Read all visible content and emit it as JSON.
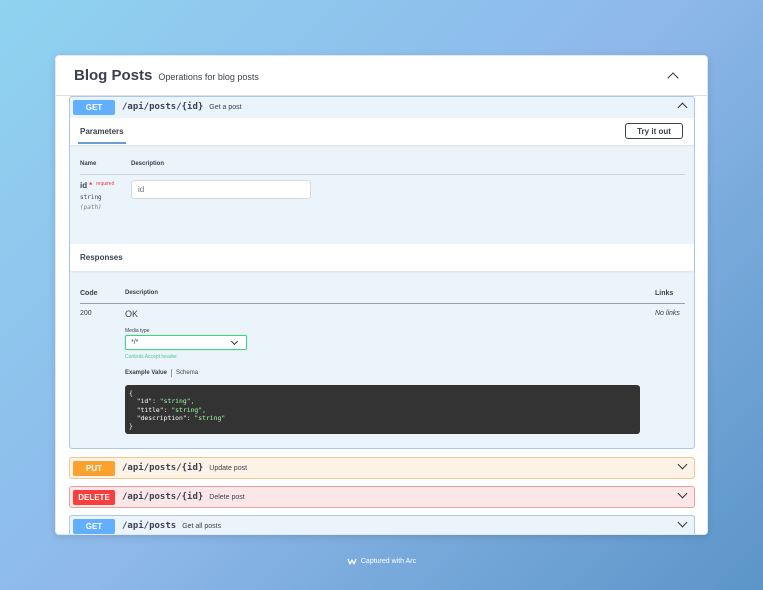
{
  "tag": {
    "title": "Blog Posts",
    "description": "Operations for blog posts"
  },
  "operations": [
    {
      "method": "GET",
      "path": "/api/posts/{id}",
      "summary": "Get a post",
      "color": "#61affe"
    },
    {
      "method": "PUT",
      "path": "/api/posts/{id}",
      "summary": "Update post",
      "color": "#fca130"
    },
    {
      "method": "DELETE",
      "path": "/api/posts/{id}",
      "summary": "Delete post",
      "color": "#f93e3e"
    },
    {
      "method": "GET",
      "path": "/api/posts",
      "summary": "Get all posts",
      "color": "#61affe"
    }
  ],
  "parameters": {
    "tab_label": "Parameters",
    "try_button": "Try it out",
    "col_name": "Name",
    "col_description": "Description",
    "param": {
      "name": "id",
      "required_mark": "*",
      "required_label": "required",
      "type": "string",
      "in": "(path)",
      "placeholder": "id"
    }
  },
  "responses": {
    "title": "Responses",
    "col_code": "Code",
    "col_description": "Description",
    "col_links": "Links",
    "row": {
      "code": "200",
      "description": "OK",
      "links": "No links",
      "media_type_label": "Media type",
      "media_type_value": "*/*",
      "accept_note": "Controls Accept header.",
      "example_value_tab": "Example Value",
      "schema_tab": "Schema",
      "example_lines": [
        "{",
        "  \"id\": ",
        "  \"title\": ",
        "  \"description\": ",
        "}"
      ],
      "example_values": [
        "\"string\",",
        "\"string\",",
        "\"string\""
      ]
    }
  },
  "footer": {
    "label": "Captured with Arc"
  },
  "colors": {
    "get": "#61affe",
    "put": "#fca130",
    "delete": "#f93e3e",
    "accept_green": "#49cc90"
  }
}
